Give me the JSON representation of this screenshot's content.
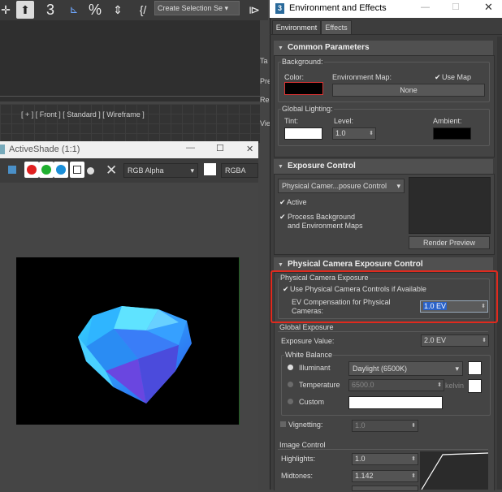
{
  "main": {
    "toolbar": {
      "selection_set": "Create Selection Se"
    },
    "viewport_label": "[ + ] [ Front ] [ Standard ] [ Wireframe ]",
    "side_tabs": [
      "Ta",
      "Pre",
      "Re",
      "Vie"
    ]
  },
  "activeshade": {
    "title": "ActiveShade (1:1)",
    "channel": "RGB Alpha",
    "channel2": "RGBA",
    "controls": {
      "minimize": "—",
      "maximize": "☐",
      "close": "✕"
    }
  },
  "dialog": {
    "title": "Environment and Effects",
    "icon": "3",
    "tabs": [
      "Environment",
      "Effects"
    ],
    "common": {
      "header": "Common Parameters",
      "background": "Background:",
      "color": "Color:",
      "env_map": "Environment Map:",
      "use_map": "Use Map",
      "none": "None",
      "global_lighting": "Global Lighting:",
      "tint": "Tint:",
      "level": "Level:",
      "level_value": "1.0",
      "ambient": "Ambient:"
    },
    "exposure": {
      "header": "Exposure Control",
      "type": "Physical Camer...posure Control",
      "active": "Active",
      "process_bg_1": "Process Background",
      "process_bg_2": "and Environment Maps",
      "render_preview": "Render Preview"
    },
    "physical": {
      "header": "Physical Camera Exposure Control",
      "group": "Physical Camera Exposure",
      "use_controls": "Use Physical Camera Controls if Available",
      "ev_comp_1": "EV Compensation for Physical",
      "ev_comp_2": "Cameras:",
      "ev_value": "1.0 EV",
      "global_exposure": "Global Exposure",
      "exposure_value_label": "Exposure Value:",
      "exposure_value": "2.0 EV",
      "white_balance": "White Balance",
      "illuminant": "Illuminant",
      "illuminant_value": "Daylight (6500K)",
      "temperature": "Temperature",
      "temperature_value": "6500.0",
      "kelvin": "kelvin",
      "custom": "Custom",
      "vignetting": "Vignetting:",
      "vignetting_value": "1.0",
      "image_control": "Image Control",
      "highlights": "Highlights:",
      "highlights_value": "1.0",
      "midtones": "Midtones:",
      "midtones_value": "1.142"
    }
  }
}
